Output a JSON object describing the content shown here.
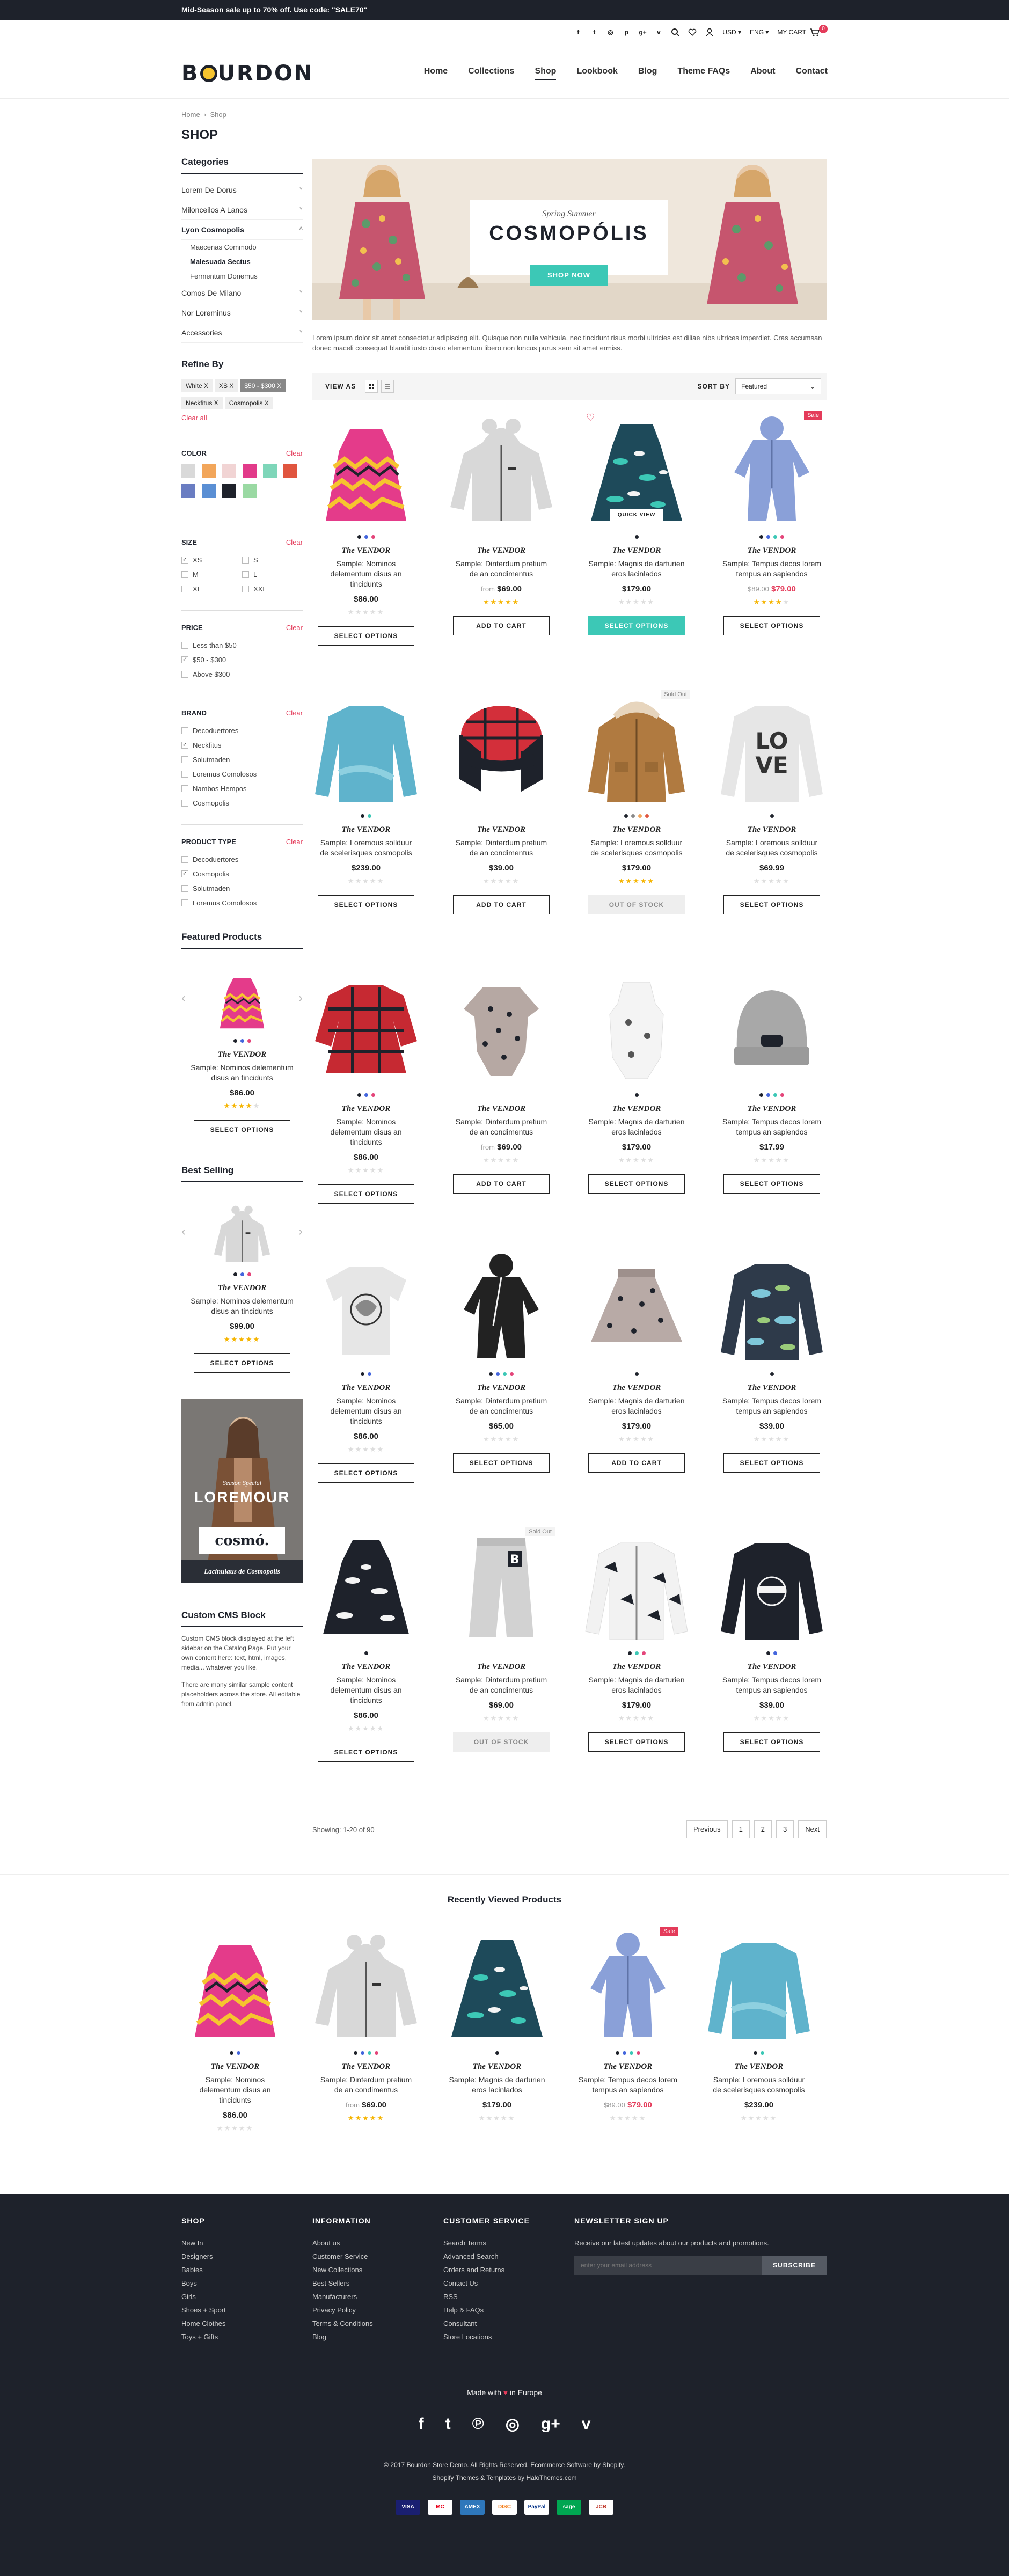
{
  "announcement": "Mid-Season sale up to 70% off. Use code: \"SALE70\"",
  "utility": {
    "currency": "USD",
    "language": "ENG",
    "cart_label": "MY CART",
    "cart_count": "0"
  },
  "logo": {
    "before": "B",
    "after": "URDON"
  },
  "nav": [
    "Home",
    "Collections",
    "Shop",
    "Lookbook",
    "Blog",
    "Theme FAQs",
    "About",
    "Contact"
  ],
  "breadcrumb": [
    "Home",
    "Shop"
  ],
  "page_title": "SHOP",
  "sidebar": {
    "categories_title": "Categories",
    "categories": [
      "Lorem De Dorus",
      "Milonceilos A Lanos",
      "Lyon Cosmopolis",
      "Comos De Milano",
      "Nor Loreminus",
      "Accessories"
    ],
    "subcategories": [
      "Maecenas Commodo",
      "Malesuada Sectus",
      "Fermentum Donemus"
    ],
    "refine_title": "Refine By",
    "active_tags": [
      "White X",
      "XS X",
      "$50 - $300 X",
      "Neckfitus X",
      "Cosmopolis X"
    ],
    "clear_all": "Clear all",
    "clear": "Clear",
    "color_title": "COLOR",
    "colors": [
      "#d9d9d9",
      "#f2a65a",
      "#f1d4d4",
      "#e23b8a",
      "#7ed6b9",
      "#e0553f",
      "#6a7dc2",
      "#5a8fd4",
      "#1e222b",
      "#9ad9a3"
    ],
    "size_title": "SIZE",
    "sizes": [
      "XS",
      "S",
      "M",
      "L",
      "XL",
      "XXL"
    ],
    "price_title": "PRICE",
    "prices": [
      "Less than $50",
      "$50 - $300",
      "Above $300"
    ],
    "brand_title": "BRAND",
    "brands": [
      "Decoduertores",
      "Neckfitus",
      "Solutmaden",
      "Loremus Comolosos",
      "Nambos Hempos",
      "Cosmopolis"
    ],
    "ptype_title": "PRODUCT TYPE",
    "ptypes": [
      "Decoduertores",
      "Cosmopolis",
      "Solutmaden",
      "Loremus Comolosos"
    ],
    "featured_title": "Featured Products",
    "featured": {
      "vendor": "The VENDOR",
      "name": "Sample: Nominos delementum disus an tincidunts",
      "price": "$86.00",
      "button": "SELECT OPTIONS"
    },
    "bestselling_title": "Best Selling",
    "bestselling": {
      "vendor": "The VENDOR",
      "name": "Sample: Nominos delementum disus an tincidunts",
      "price": "$99.00",
      "button": "SELECT OPTIONS"
    },
    "promo": {
      "small": "Season Special",
      "big": "LOREMOUR",
      "brand": "cosmó.",
      "caption": "Lacinulaus de Cosmopolis"
    },
    "cms_title": "Custom CMS Block",
    "cms_p1": "Custom CMS block displayed at the left sidebar on the Catalog Page. Put your own content here: text, html, images, media... whatever you like.",
    "cms_p2": "There are many similar sample content placeholders across the store. All editable from admin panel."
  },
  "banner": {
    "kicker": "Spring Summer",
    "title": "COSMOPÓLIS",
    "button": "SHOP NOW"
  },
  "intro": "Lorem ipsum dolor sit amet consectetur adipiscing elit. Quisque non nulla vehicula, nec tincidunt risus morbi ultricies est diliae nibs ultrices imperdiet. Cras accumsan donec maceli consequat blandit iusto dusto elementum libero non loncus purus sem sit amet ermiss.",
  "toolbar": {
    "view_as": "VIEW AS",
    "sort_by": "SORT BY",
    "sort_value": "Featured"
  },
  "products": [
    {
      "v": "The VENDOR",
      "n": "Sample: Nominos delementum disus an tincidunts",
      "p": "$86.00",
      "b": "SELECT OPTIONS",
      "s": 0,
      "art": "dress-zig",
      "dots": [
        "#1e222b",
        "#4466dd",
        "#e4457a"
      ]
    },
    {
      "v": "The VENDOR",
      "n": "Sample: Dinterdum pretium de an condimentus",
      "from": "from",
      "p": "$69.00",
      "b": "ADD TO CART",
      "s": 5,
      "art": "hoodie-grey",
      "dots": []
    },
    {
      "v": "The VENDOR",
      "n": "Sample: Magnis de darturien eros lacinlados",
      "p": "$179.00",
      "b": "SELECT OPTIONS",
      "s": 0,
      "art": "dress-leaf",
      "dots": [
        "#1e222b"
      ],
      "teal": true,
      "qv": "QUICK VIEW",
      "wish": true
    },
    {
      "v": "The VENDOR",
      "n": "Sample: Tempus decos lorem tempus an sapiendos",
      "old": "$89.00",
      "p": "$79.00",
      "b": "SELECT OPTIONS",
      "s": 4,
      "art": "onesie-blue",
      "dots": [
        "#1e222b",
        "#4466dd",
        "#3cc8b6",
        "#e4457a"
      ],
      "sale": "Sale"
    },
    {
      "v": "The VENDOR",
      "n": "Sample: Loremous sollduur de scelerisques cosmopolis",
      "p": "$239.00",
      "b": "SELECT OPTIONS",
      "s": 0,
      "art": "sweat-teal",
      "dots": [
        "#1e222b",
        "#3cc8b6"
      ]
    },
    {
      "v": "The VENDOR",
      "n": "Sample: Dinterdum pretium de an condimentus",
      "p": "$39.00",
      "b": "ADD TO CART",
      "s": 0,
      "art": "hat-red",
      "dots": []
    },
    {
      "v": "The VENDOR",
      "n": "Sample: Loremous sollduur de scelerisques cosmopolis",
      "p": "$179.00",
      "b": "OUT OF STOCK",
      "s": 5,
      "art": "parka",
      "dots": [
        "#1e222b",
        "#888",
        "#f2a65a",
        "#e0553f"
      ],
      "grey": true,
      "sold": "Sold Out"
    },
    {
      "v": "The VENDOR",
      "n": "Sample: Loremous sollduur de scelerisques cosmopolis",
      "p": "$69.99",
      "b": "SELECT OPTIONS",
      "s": 0,
      "art": "sweat-love",
      "dots": [
        "#1e222b"
      ]
    },
    {
      "v": "The VENDOR",
      "n": "Sample: Nominos delementum disus an tincidunts",
      "p": "$86.00",
      "b": "SELECT OPTIONS",
      "s": 0,
      "art": "dress-red",
      "dots": [
        "#1e222b",
        "#4466dd",
        "#e4457a"
      ]
    },
    {
      "v": "The VENDOR",
      "n": "Sample: Dinterdum pretium de an condimentus",
      "from": "from",
      "p": "$69.00",
      "b": "ADD TO CART",
      "s": 0,
      "art": "body-dots",
      "dots": []
    },
    {
      "v": "The VENDOR",
      "n": "Sample: Magnis de darturien eros lacinlados",
      "p": "$179.00",
      "b": "SELECT OPTIONS",
      "s": 0,
      "art": "body-white",
      "dots": [
        "#1e222b"
      ]
    },
    {
      "v": "The VENDOR",
      "n": "Sample: Tempus decos lorem tempus an sapiendos",
      "p": "$17.99",
      "b": "SELECT OPTIONS",
      "s": 0,
      "art": "beanie",
      "dots": [
        "#1e222b",
        "#4466dd",
        "#3cc8b6",
        "#e4457a"
      ]
    },
    {
      "v": "The VENDOR",
      "n": "Sample: Nominos delementum disus an tincidunts",
      "p": "$86.00",
      "b": "SELECT OPTIONS",
      "s": 0,
      "art": "tee-grey",
      "dots": [
        "#1e222b",
        "#4466dd"
      ]
    },
    {
      "v": "The VENDOR",
      "n": "Sample: Dinterdum pretium de an condimentus",
      "p": "$65.00",
      "b": "SELECT OPTIONS",
      "s": 0,
      "art": "onesie-black",
      "dots": [
        "#1e222b",
        "#4466dd",
        "#3cc8b6",
        "#e4457a"
      ]
    },
    {
      "v": "The VENDOR",
      "n": "Sample: Magnis de darturien eros lacinlados",
      "p": "$179.00",
      "b": "ADD TO CART",
      "s": 0,
      "art": "skirt",
      "dots": [
        "#1e222b"
      ]
    },
    {
      "v": "The VENDOR",
      "n": "Sample: Tempus decos lorem tempus an sapiendos",
      "p": "$39.00",
      "b": "SELECT OPTIONS",
      "s": 0,
      "art": "sweat-camo",
      "dots": [
        "#1e222b"
      ]
    },
    {
      "v": "The VENDOR",
      "n": "Sample: Nominos delementum disus an tincidunts",
      "p": "$86.00",
      "b": "SELECT OPTIONS",
      "s": 0,
      "art": "dress-bw",
      "dots": [
        "#1e222b"
      ]
    },
    {
      "v": "The VENDOR",
      "n": "Sample: Dinterdum pretium de an condimentus",
      "p": "$69.00",
      "b": "OUT OF STOCK",
      "s": 0,
      "art": "pants-grey",
      "dots": [],
      "grey": true,
      "sold": "Sold Out"
    },
    {
      "v": "The VENDOR",
      "n": "Sample: Magnis de darturien eros lacinlados",
      "p": "$179.00",
      "b": "SELECT OPTIONS",
      "s": 0,
      "art": "jacket-bw",
      "dots": [
        "#1e222b",
        "#3cc8b6",
        "#e4457a"
      ]
    },
    {
      "v": "The VENDOR",
      "n": "Sample: Tempus decos lorem tempus an sapiendos",
      "p": "$39.00",
      "b": "SELECT OPTIONS",
      "s": 0,
      "art": "tee-black",
      "dots": [
        "#1e222b",
        "#4466dd"
      ]
    }
  ],
  "pagination": {
    "showing": "Showing: 1-20 of 90",
    "prev": "Previous",
    "pages": [
      "1",
      "2",
      "3"
    ],
    "next": "Next"
  },
  "recent": {
    "title": "Recently Viewed Products",
    "items": [
      {
        "v": "The VENDOR",
        "n": "Sample: Nominos delementum disus an tincidunts",
        "p": "$86.00",
        "s": 0,
        "art": "dress-zig",
        "dots": [
          "#1e222b",
          "#4466dd"
        ]
      },
      {
        "v": "The VENDOR",
        "n": "Sample: Dinterdum pretium de an condimentus",
        "from": "from",
        "p": "$69.00",
        "s": 5,
        "art": "hoodie-grey",
        "dots": [
          "#1e222b",
          "#4466dd",
          "#3cc8b6",
          "#e4457a"
        ]
      },
      {
        "v": "The VENDOR",
        "n": "Sample: Magnis de darturien eros lacinlados",
        "p": "$179.00",
        "s": 0,
        "art": "dress-leaf",
        "dots": [
          "#1e222b"
        ]
      },
      {
        "v": "The VENDOR",
        "n": "Sample: Tempus decos lorem tempus an sapiendos",
        "old": "$89.00",
        "p": "$79.00",
        "s": 0,
        "art": "onesie-blue",
        "dots": [
          "#1e222b",
          "#4466dd",
          "#3cc8b6",
          "#e4457a"
        ],
        "sale": "Sale"
      },
      {
        "v": "The VENDOR",
        "n": "Sample: Loremous sollduur de scelerisques cosmopolis",
        "p": "$239.00",
        "s": 0,
        "art": "sweat-teal",
        "dots": [
          "#1e222b",
          "#3cc8b6"
        ]
      }
    ]
  },
  "footer": {
    "shop_title": "SHOP",
    "shop": [
      "New In",
      "Designers",
      "Babies",
      "Boys",
      "Girls",
      "Shoes + Sport",
      "Home Clothes",
      "Toys + Gifts"
    ],
    "info_title": "INFORMATION",
    "info": [
      "About us",
      "Customer Service",
      "New Collections",
      "Best Sellers",
      "Manufacturers",
      "Privacy Policy",
      "Terms & Conditions",
      "Blog"
    ],
    "cs_title": "CUSTOMER SERVICE",
    "cs": [
      "Search Terms",
      "Advanced Search",
      "Orders and Returns",
      "Contact Us",
      "RSS",
      "Help & FAQs",
      "Consultant",
      "Store Locations"
    ],
    "news_title": "NEWSLETTER SIGN UP",
    "news_text": "Receive our latest updates about our products and promotions.",
    "email_placeholder": "enter your email address",
    "subscribe": "SUBSCRIBE",
    "made_with": "Made with",
    "in_europe": "in Europe",
    "copyright": "© 2017 Bourdon Store Demo. All Rights Reserved. Ecommerce Software by Shopify.",
    "credit": "Shopify Themes & Templates by HaloThemes.com",
    "payments": [
      "VISA",
      "MC",
      "AMEX",
      "DISC",
      "PayPal",
      "sage",
      "JCB"
    ]
  }
}
